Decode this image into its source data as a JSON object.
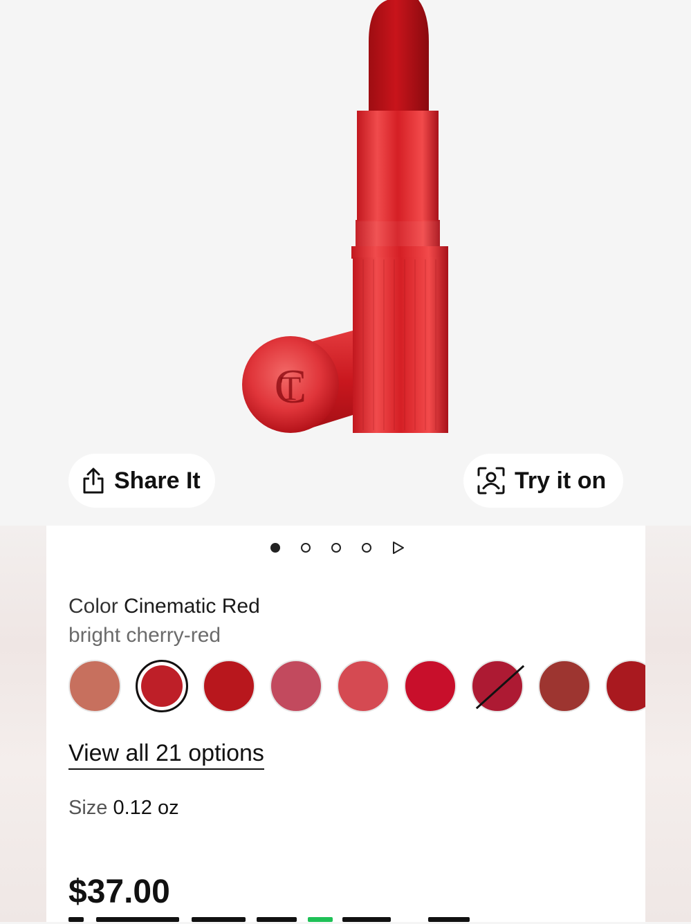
{
  "hero": {
    "share_label": "Share It",
    "try_label": "Try it on",
    "share_icon": "share-icon",
    "try_icon": "face-scan-icon",
    "carousel_count": 4,
    "carousel_active": 0
  },
  "product": {
    "color_label": "Color",
    "color_name": "Cinematic Red",
    "color_description": "bright cherry-red",
    "view_all_label": "View all 21 options",
    "size_label": "Size",
    "size_value": "0.12 oz",
    "price": "$37.00"
  },
  "swatches": [
    {
      "color": "#c7705e",
      "selected": false,
      "unavailable": false
    },
    {
      "color": "#be1f28",
      "selected": true,
      "unavailable": false
    },
    {
      "color": "#b8171d",
      "selected": false,
      "unavailable": false
    },
    {
      "color": "#c24a5e",
      "selected": false,
      "unavailable": false
    },
    {
      "color": "#d54a52",
      "selected": false,
      "unavailable": false
    },
    {
      "color": "#c80f2b",
      "selected": false,
      "unavailable": false
    },
    {
      "color": "#ad1a33",
      "selected": false,
      "unavailable": true
    },
    {
      "color": "#9d3530",
      "selected": false,
      "unavailable": false
    },
    {
      "color": "#a9191f",
      "selected": false,
      "unavailable": false
    }
  ]
}
